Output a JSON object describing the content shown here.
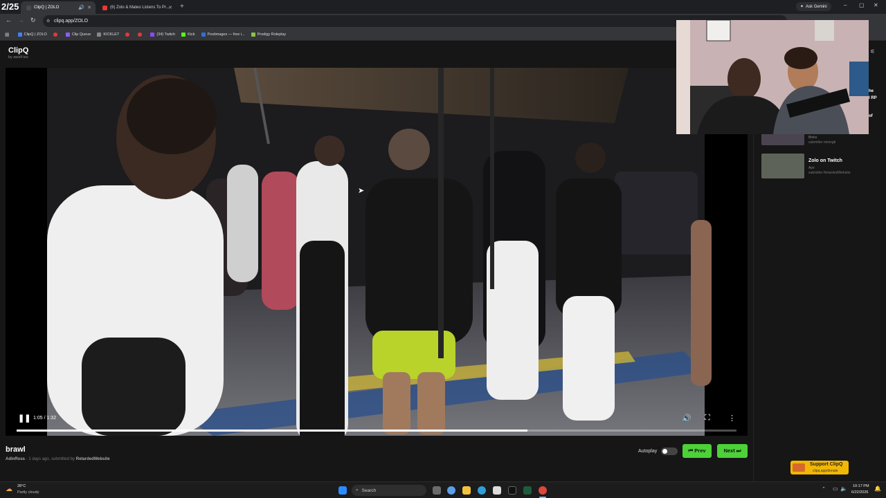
{
  "tabs": [
    {
      "label": "ClipQ | ZOLO",
      "color": "#4a4a4a"
    },
    {
      "label": "(6) Zolo & Mateo Listens To Pr...",
      "color": "#e53935"
    }
  ],
  "tab_strip": {
    "clock_badge": "2/25",
    "ask_gemini": "Ask Gemini"
  },
  "address": {
    "url": "clipq.app/ZOLO"
  },
  "bookmarks": [
    {
      "label": "ClipQ | ZOLO",
      "color": "#3b82f6"
    },
    {
      "label": "",
      "color": "#e53935"
    },
    {
      "label": "Clip Queue",
      "color": "#8b5cf6"
    },
    {
      "label": "KICKLET",
      "color": "#888888"
    },
    {
      "label": "",
      "color": "#e53935"
    },
    {
      "label": "",
      "color": "#e53935"
    },
    {
      "label": "(34) Twitch",
      "color": "#9146ff"
    },
    {
      "label": "Kick",
      "color": "#53fc18"
    },
    {
      "label": "Postimages — free i...",
      "color": "#2f6fd6"
    },
    {
      "label": "Prodigy Roleplay",
      "color": "#8bc34a"
    }
  ],
  "brand": {
    "name": "ClipQ",
    "byline": "by awolf.tsx"
  },
  "video": {
    "time": "1:05 / 1:32",
    "progress": 0.71,
    "pause_icon": "pause-icon",
    "volume_icon": "volume-icon",
    "fullscreen_icon": "fullscreen-icon",
    "more_icon": "more-vertical-icon"
  },
  "clip": {
    "title": "brawl",
    "channel": "AdinRoss",
    "meta_mid": " - 1 days ago, submitted by ",
    "submitter": "RetardedWebsite"
  },
  "controls": {
    "autoplay_label": "Autoplay",
    "autoplay_on": false,
    "prev_label": "⏮ Prev",
    "next_label": "Next ⏭"
  },
  "sidebar": {
    "partial_lines": [
      "he",
      "l RP",
      "of"
    ],
    "items": [
      {
        "title": "",
        "sub1": "Binks",
        "sub2": "submitter mismgb"
      },
      {
        "title": "Zolo on Twitch",
        "sub1": "Ayo",
        "sub2": "submitter RetardedWebsite"
      }
    ],
    "support": {
      "title": "Support ClipQ",
      "url": "clipq.app/donate"
    }
  },
  "taskbar": {
    "weather_temp": "28°C",
    "weather_desc": "Partly cloudy",
    "search_placeholder": "Search",
    "time": "10:17 PM",
    "date": "6/22/2026"
  },
  "colors": {
    "accent_green": "#4cd137",
    "progress_red": "#ffffff"
  }
}
